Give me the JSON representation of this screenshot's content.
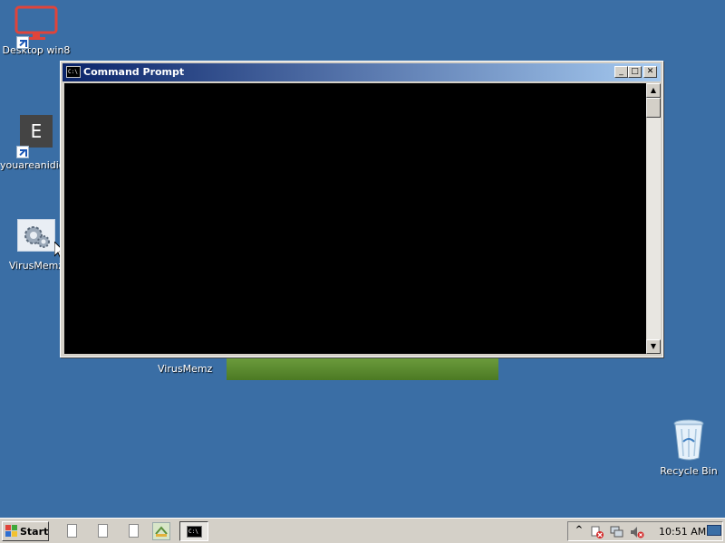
{
  "desktop": {
    "icons": [
      {
        "label": "Desktop win8",
        "icon": "monitor-icon"
      },
      {
        "label": "youareanidio...",
        "icon": "letter-e-icon",
        "glyph": "E"
      },
      {
        "label": "VirusMemz",
        "icon": "gears-icon"
      }
    ],
    "floating_label": "VirusMemz",
    "recycle_bin": {
      "label": "Recycle Bin",
      "icon": "recycle-bin-icon"
    }
  },
  "window": {
    "title": "Command Prompt",
    "icon_text": "C:\\",
    "buttons": {
      "minimize": "_",
      "maximize": "□",
      "close": "✕"
    },
    "scroll_up": "▲",
    "scroll_down": "▼"
  },
  "taskbar": {
    "start_label": "Start",
    "task_icon_text": "C:\\",
    "clock": "10:51 AM",
    "tray_expand": "^",
    "colors": {
      "background": "#d4d0c8",
      "desktop": "#3a6ea5",
      "title_start": "#0a246a",
      "title_end": "#a6caf0"
    }
  }
}
